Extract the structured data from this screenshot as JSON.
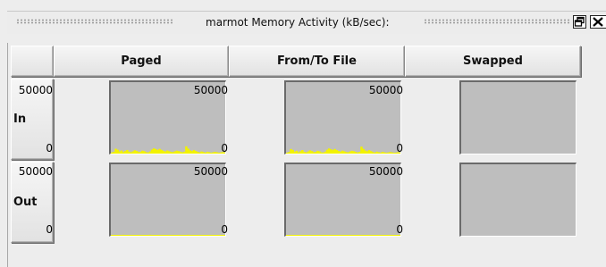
{
  "window": {
    "title": "marmot Memory Activity (kB/sec):",
    "float_icon": "float-window-icon",
    "close_icon": "close-icon"
  },
  "columns": [
    "Paged",
    "From/To File",
    "Swapped"
  ],
  "rows": [
    "In",
    "Out"
  ],
  "axis": {
    "max_label": "50000",
    "min_label": "0"
  },
  "graph_colors": {
    "fill": "#f2f200",
    "background": "#bebebe"
  },
  "chart_data": [
    {
      "type": "area",
      "row": "In",
      "column": "Paged",
      "ylim": [
        0,
        50000
      ],
      "values": [
        800,
        1200,
        3500,
        2800,
        1500,
        2200,
        1000,
        1800,
        2600,
        1400,
        900,
        1600,
        2400,
        1900,
        1100,
        1300,
        2100,
        1700,
        1000,
        800,
        1500,
        2900,
        3800,
        3200,
        2600,
        3400,
        2700,
        2000,
        1500,
        2200,
        1700,
        1200,
        1000,
        1600,
        2100,
        1800,
        1300,
        900,
        1400,
        5200,
        3600,
        2300,
        1800,
        2600,
        1900,
        1200,
        800,
        1500,
        1100,
        700,
        1300,
        1000,
        600,
        900,
        1200,
        1000,
        700,
        800,
        1100,
        900
      ]
    },
    {
      "type": "area",
      "row": "In",
      "column": "From/To File",
      "ylim": [
        0,
        50000
      ],
      "values": [
        700,
        1100,
        3300,
        2600,
        1400,
        2000,
        900,
        1700,
        2500,
        1300,
        800,
        1500,
        2300,
        1800,
        1000,
        1200,
        2000,
        1600,
        900,
        700,
        1400,
        2800,
        3700,
        3100,
        2500,
        3300,
        2600,
        1900,
        1400,
        2100,
        1600,
        1100,
        900,
        1500,
        2000,
        1700,
        1200,
        800,
        1300,
        5000,
        3400,
        2200,
        1700,
        2500,
        1800,
        1100,
        700,
        1400,
        1000,
        600,
        1200,
        900,
        500,
        800,
        1100,
        900,
        600,
        700,
        1000,
        800
      ]
    },
    {
      "type": "area",
      "row": "In",
      "column": "Swapped",
      "ylim": [
        0,
        50000
      ],
      "values": []
    },
    {
      "type": "area",
      "row": "Out",
      "column": "Paged",
      "ylim": [
        0,
        50000
      ],
      "values": [
        300,
        500,
        200,
        600,
        400,
        300,
        700,
        250,
        450,
        350,
        600,
        200,
        500,
        300,
        650,
        400,
        250,
        550,
        350,
        300,
        700,
        450,
        200,
        500,
        400,
        600,
        300,
        350,
        550,
        250,
        450,
        300,
        650,
        400,
        200,
        500,
        350,
        600,
        300,
        450,
        700,
        250,
        400,
        550,
        300,
        350,
        600,
        200,
        500,
        400,
        300,
        450,
        250,
        600,
        350,
        500,
        300,
        400,
        250,
        350
      ]
    },
    {
      "type": "area",
      "row": "Out",
      "column": "From/To File",
      "ylim": [
        0,
        50000
      ],
      "values": [
        300,
        450,
        250,
        550,
        400,
        300,
        650,
        250,
        450,
        350,
        550,
        200,
        500,
        300,
        600,
        400,
        250,
        500,
        350,
        300,
        650,
        450,
        200,
        500,
        400,
        550,
        300,
        350,
        500,
        250,
        450,
        300,
        600,
        400,
        200,
        500,
        350,
        550,
        300,
        450,
        650,
        250,
        400,
        500,
        300,
        350,
        550,
        200,
        500,
        400,
        300,
        450,
        250,
        550,
        350,
        500,
        300,
        400,
        250,
        350
      ]
    },
    {
      "type": "area",
      "row": "Out",
      "column": "Swapped",
      "ylim": [
        0,
        50000
      ],
      "values": []
    }
  ]
}
